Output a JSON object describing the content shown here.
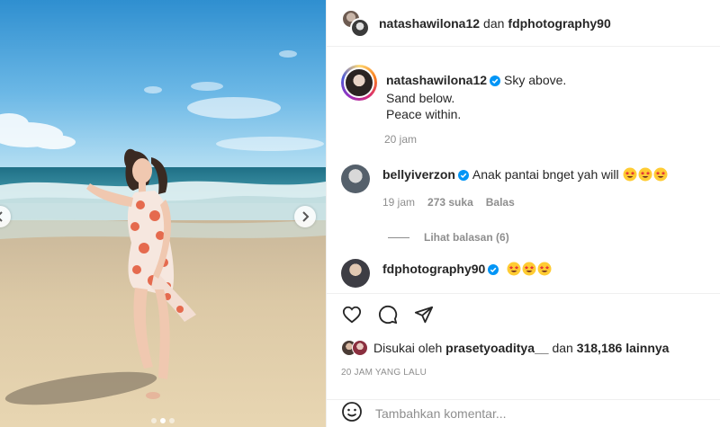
{
  "header": {
    "user1": "natashawilona12",
    "connector": "dan",
    "user2": "fdphotography90"
  },
  "caption": {
    "username": "natashawilona12",
    "line1": "Sky above.",
    "line2": "Sand below.",
    "line3": "Peace within.",
    "time": "20 jam"
  },
  "comments": [
    {
      "username": "bellyiverzon",
      "text": "Anak pantai bnget yah will",
      "time": "19 jam",
      "likes": "273 suka",
      "reply_label": "Balas",
      "view_replies": "Lihat balasan (6)"
    },
    {
      "username": "fdphotography90",
      "text": ""
    }
  ],
  "likes": {
    "prefix": "Disukai oleh",
    "user": "prasetyoaditya__",
    "connector": "dan",
    "count": "318,186 lainnya"
  },
  "timestamp": "20 JAM YANG LALU",
  "add_comment": {
    "placeholder": "Tambahkan komentar..."
  },
  "carousel": {
    "total_slides": 3,
    "active_slide": 2
  },
  "colors": {
    "verified_blue": "#0095f6",
    "text": "#262626",
    "muted": "#8e8e8e"
  }
}
